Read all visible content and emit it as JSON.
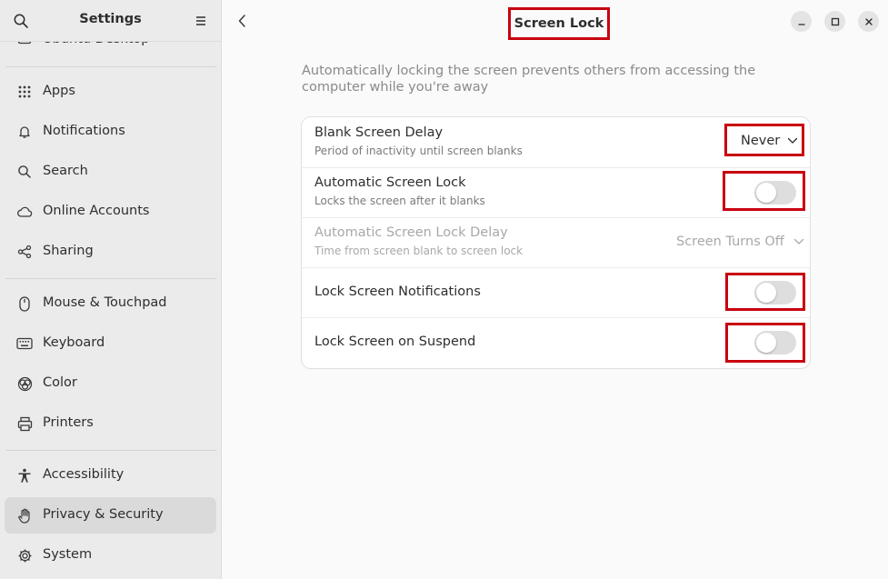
{
  "sidebar": {
    "title": "Settings",
    "partial_item": "Ubuntu Desktop",
    "items": [
      {
        "label": "Apps",
        "icon": "apps-icon"
      },
      {
        "label": "Notifications",
        "icon": "bell-icon"
      },
      {
        "label": "Search",
        "icon": "search-icon"
      },
      {
        "label": "Online Accounts",
        "icon": "cloud-icon"
      },
      {
        "label": "Sharing",
        "icon": "share-icon"
      },
      {
        "label": "Mouse & Touchpad",
        "icon": "mouse-icon"
      },
      {
        "label": "Keyboard",
        "icon": "keyboard-icon"
      },
      {
        "label": "Color",
        "icon": "color-icon"
      },
      {
        "label": "Printers",
        "icon": "printer-icon"
      },
      {
        "label": "Accessibility",
        "icon": "accessibility-icon"
      },
      {
        "label": "Privacy & Security",
        "icon": "hand-icon",
        "active": true
      },
      {
        "label": "System",
        "icon": "gear-icon"
      }
    ]
  },
  "main": {
    "title": "Screen Lock",
    "description": "Automatically locking the screen prevents others from accessing the computer while you're away",
    "rows": [
      {
        "title": "Blank Screen Delay",
        "subtitle": "Period of inactivity until screen blanks",
        "control": "dropdown",
        "value": "Never"
      },
      {
        "title": "Automatic Screen Lock",
        "subtitle": "Locks the screen after it blanks",
        "control": "toggle",
        "state": false
      },
      {
        "title": "Automatic Screen Lock Delay",
        "subtitle": "Time from screen blank to screen lock",
        "control": "dropdown",
        "value": "Screen Turns Off",
        "disabled": true
      },
      {
        "title": "Lock Screen Notifications",
        "control": "toggle",
        "state": false
      },
      {
        "title": "Lock Screen on Suspend",
        "control": "toggle",
        "state": false
      }
    ]
  },
  "colors": {
    "highlight": "#c8000f",
    "sidebar_bg": "#ebebeb",
    "active_item_bg": "#dadada",
    "toggle_off": "#dedede"
  }
}
